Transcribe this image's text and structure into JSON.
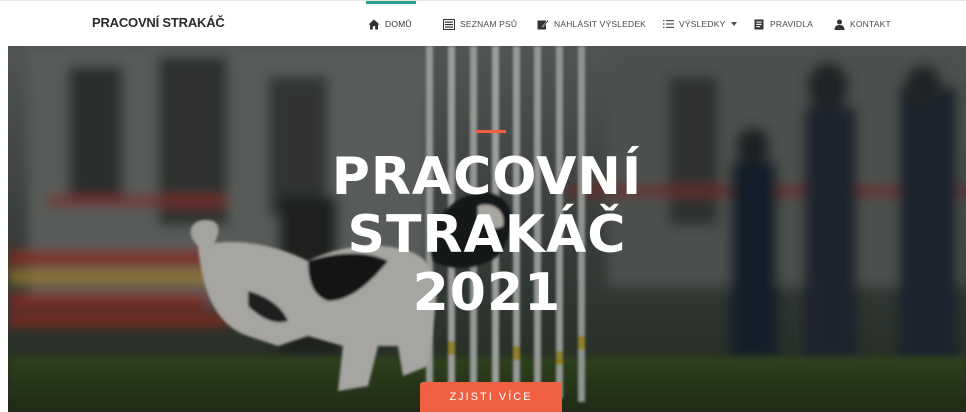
{
  "navbar": {
    "brand": "PRACOVNÍ STRAKÁČ",
    "items": [
      {
        "label": "DOMŮ",
        "icon": "home-icon",
        "active": true
      },
      {
        "label": "SEZNAM PSŮ",
        "icon": "list-icon"
      },
      {
        "label": "NAHLÁSIT VÝSLEDEK",
        "icon": "edit-icon"
      },
      {
        "label": "VÝSLEDKY",
        "icon": "list-ordered-icon",
        "dropdown": true
      },
      {
        "label": "PRAVIDLA",
        "icon": "book-icon"
      },
      {
        "label": "KONTAKT",
        "icon": "user-icon"
      }
    ]
  },
  "hero": {
    "title_lines": [
      "PRACOVNÍ",
      "STRAKÁČ",
      "2021"
    ],
    "cta_label": "ZJISTI VÍCE"
  },
  "colors": {
    "accent": "#f05f40",
    "active_nav": "#2a9d8f"
  }
}
